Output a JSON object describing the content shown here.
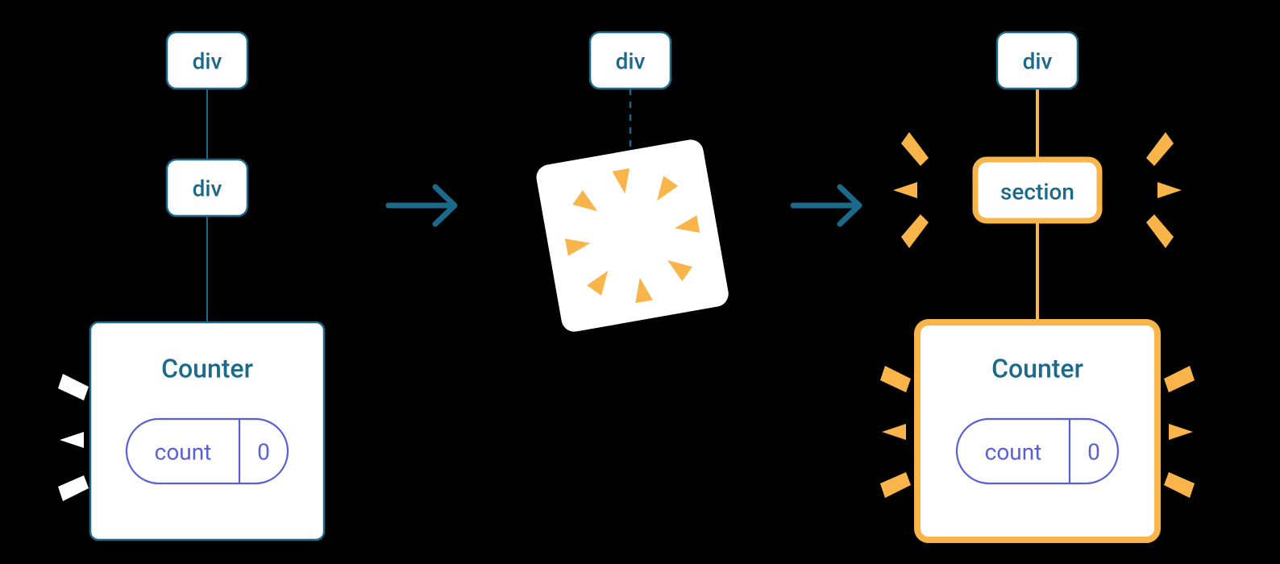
{
  "colors": {
    "blueStroke": "#1b6a8c",
    "blueText": "#1b6a8c",
    "purple": "#5860d6",
    "orange": "#f9b54a",
    "boxFill": "#ffffff"
  },
  "left": {
    "top": {
      "label": "div"
    },
    "mid": {
      "label": "div"
    },
    "counter": {
      "title": "Counter",
      "pill": {
        "name": "count",
        "value": "0"
      }
    }
  },
  "center": {
    "top": {
      "label": "div"
    }
  },
  "right": {
    "top": {
      "label": "div"
    },
    "mid": {
      "label": "section"
    },
    "counter": {
      "title": "Counter",
      "pill": {
        "name": "count",
        "value": "0"
      }
    }
  },
  "arrows": {
    "a1": "→",
    "a2": "→"
  }
}
